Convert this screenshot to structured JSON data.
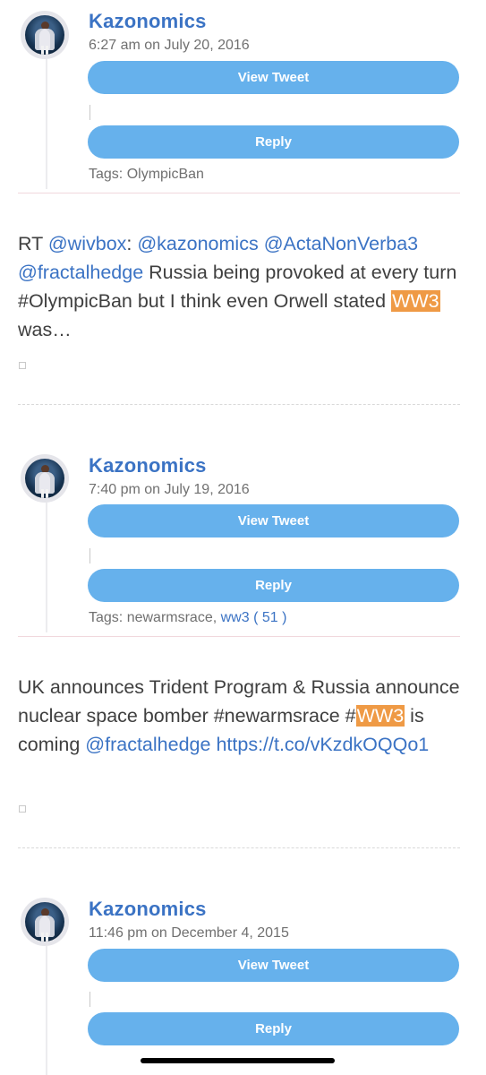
{
  "entries": [
    {
      "author": "Kazonomics",
      "timestamp": "6:27 am on July 20, 2016",
      "view_tweet_label": "View Tweet",
      "reply_label": "Reply",
      "tags_prefix": "Tags: ",
      "tags_text": "OlympicBan",
      "tweet": {
        "rt": "RT ",
        "mention1": "@wivbox",
        "colon": ": ",
        "mention2": "@kazonomics",
        "space1": " ",
        "mention3": "@ActaNonVerba3",
        "space2": " ",
        "mention4": "@fractalhedge",
        "body": " Russia being provoked at every turn #OlympicBan but I think even Orwell stated ",
        "highlight": "WW3",
        "tail": " was…"
      }
    },
    {
      "author": "Kazonomics",
      "timestamp": "7:40 pm on July 19, 2016",
      "view_tweet_label": "View Tweet",
      "reply_label": "Reply",
      "tags_prefix": "Tags: ",
      "tags_text": "newarmsrace, ",
      "tags_link": "ww3 ( 51 )",
      "tweet": {
        "body": "UK announces Trident Program & Russia announce nuclear space bomber #newarmsrace #",
        "highlight": "WW3",
        "middle": " is coming ",
        "mention": "@fractalhedge",
        "space": " ",
        "url": "https://t.co/vKzdkOQQo1"
      }
    },
    {
      "author": "Kazonomics",
      "timestamp": "11:46 pm on December 4, 2015",
      "view_tweet_label": "View Tweet",
      "reply_label": "Reply"
    }
  ],
  "colors": {
    "accent_blue": "#3b73c4",
    "button_blue": "#66b1ec",
    "highlight_orange": "#ef9a45"
  },
  "icons": {
    "avatar": "profile-photo",
    "checkbox": "small-square-icon"
  }
}
